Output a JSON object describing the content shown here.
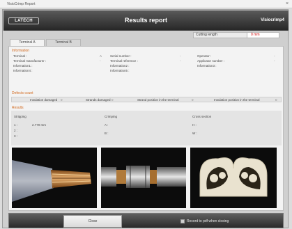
{
  "window": {
    "title": "VisioCrimp Report"
  },
  "header": {
    "logo": "LATECH",
    "title": "Results report",
    "app": "Visiocrimp4"
  },
  "cutting": {
    "label": "Cutting length",
    "value": "0 mm"
  },
  "tabs": [
    {
      "label": "Terminal A"
    },
    {
      "label": "Terminal B"
    }
  ],
  "information": {
    "title": "Information",
    "col1": [
      {
        "label": "Terminal :",
        "value": "A"
      },
      {
        "label": "Terminal manufacturer :",
        "value": "-"
      },
      {
        "label": "Information1 :",
        "value": ""
      },
      {
        "label": "Information4 :",
        "value": ""
      }
    ],
    "col2": [
      {
        "label": "Serial number :",
        "value": "-"
      },
      {
        "label": "Terminal reference :",
        "value": "-"
      },
      {
        "label": "Information2 :",
        "value": ""
      },
      {
        "label": "Information5 :",
        "value": ""
      }
    ],
    "col3": [
      {
        "label": "Operator :",
        "value": "-"
      },
      {
        "label": "Applicator number :",
        "value": "-"
      },
      {
        "label": "Information3 :",
        "value": ""
      }
    ]
  },
  "defects": {
    "title": "Defects count",
    "items": [
      {
        "label": "Insulation damaged",
        "value": "0"
      },
      {
        "label": "Strands damaged",
        "value": "0"
      },
      {
        "label": "Strand position in the terminal",
        "value": "0"
      },
      {
        "label": "Insulation position in the terminal",
        "value": "0"
      }
    ]
  },
  "results": {
    "title": "Results",
    "stripping": {
      "title": "Stripping",
      "rows": [
        {
          "label": "1 :",
          "value": "2.770 mm"
        },
        {
          "label": "2 :",
          "value": ""
        },
        {
          "label": "3 :",
          "value": ""
        }
      ]
    },
    "crimping": {
      "title": "Crimping",
      "rows": [
        {
          "label": "A :",
          "value": ""
        },
        {
          "label": "B :",
          "value": ""
        }
      ]
    },
    "cross": {
      "title": "Cross section",
      "rows": [
        {
          "label": "H :",
          "value": ""
        },
        {
          "label": "W :",
          "value": ""
        }
      ]
    }
  },
  "footer": {
    "close_label": "Close",
    "record_label": "Record to pdf when closing"
  }
}
